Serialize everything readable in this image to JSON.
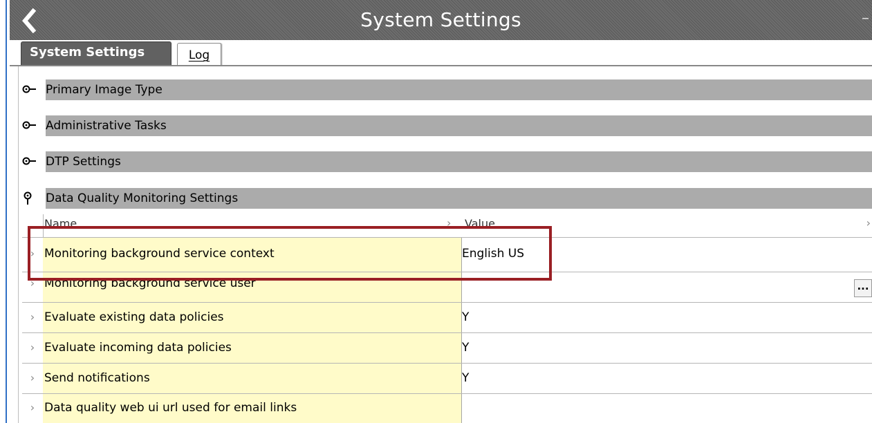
{
  "window": {
    "title": "System Settings",
    "minimize_glyph": "–"
  },
  "tabs": [
    {
      "label": "System Settings",
      "active": true
    },
    {
      "label": "Log",
      "active": false
    }
  ],
  "sections": [
    {
      "label": "Primary Image Type",
      "expanded": false
    },
    {
      "label": "Administrative Tasks",
      "expanded": false
    },
    {
      "label": "DTP Settings",
      "expanded": false
    },
    {
      "label": "Data Quality Monitoring Settings",
      "expanded": true
    }
  ],
  "grid": {
    "columns": {
      "name": "Name",
      "value": "Value"
    },
    "sort_glyph": "›",
    "row_chevron": "›",
    "rows": [
      {
        "name": "Monitoring background service context",
        "value": "English US"
      },
      {
        "name": "Monitoring background service user",
        "value": "",
        "button": "..."
      },
      {
        "name": "Evaluate existing data policies",
        "value": "Y"
      },
      {
        "name": "Evaluate incoming data policies",
        "value": "Y"
      },
      {
        "name": "Send notifications",
        "value": "Y"
      },
      {
        "name": "Data quality web ui url used for email links",
        "value": ""
      }
    ]
  },
  "colors": {
    "highlight": "#9a1f24",
    "name_cell_bg": "#fffbc9",
    "section_bar": "#ababab",
    "active_tab": "#616161"
  }
}
